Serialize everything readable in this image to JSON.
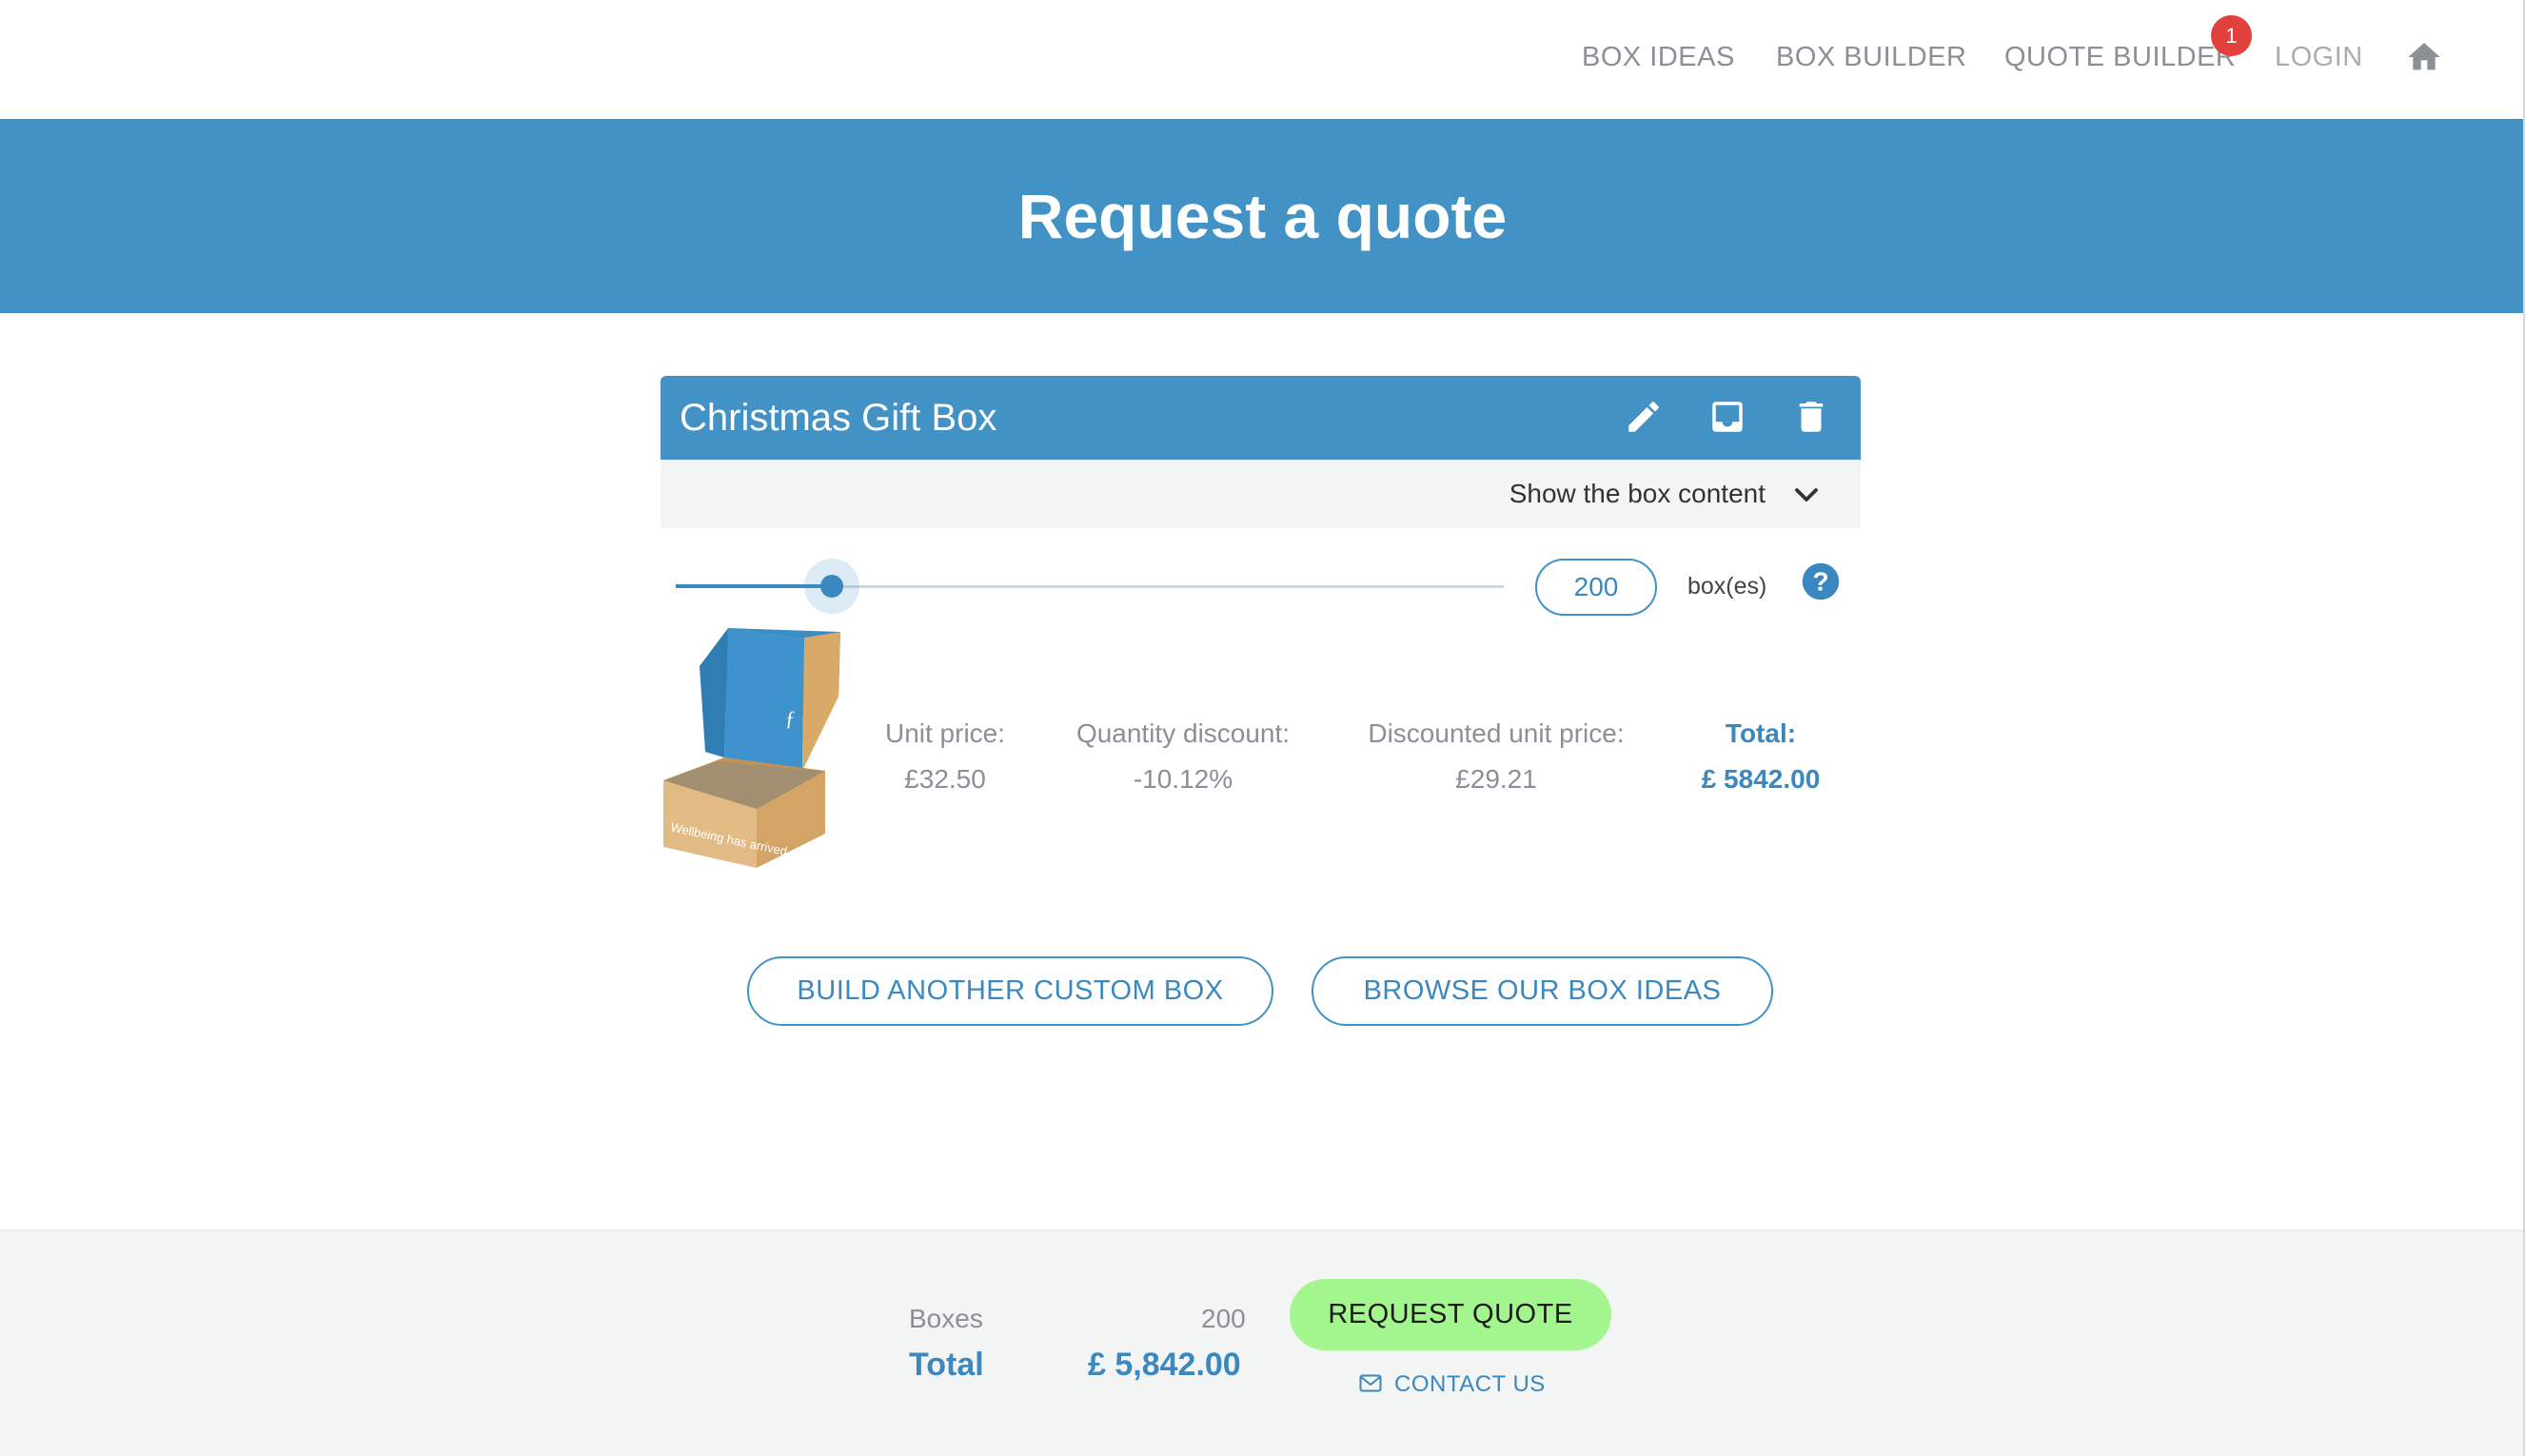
{
  "nav": {
    "items": [
      "BOX IDEAS",
      "BOX BUILDER",
      "QUOTE BUILDER"
    ],
    "login": "LOGIN",
    "cart_badge": "1",
    "home_icon": "home-icon"
  },
  "banner": {
    "title": "Request a quote"
  },
  "box": {
    "title": "Christmas Gift Box",
    "actions": [
      "pencil-icon",
      "inbox-icon",
      "trash-icon"
    ],
    "content_toggle": "Show the box content",
    "quantity": "200",
    "quantity_unit": "box(es)",
    "slider_fraction": 0.2,
    "box_print": "Wellbeing has arrived",
    "unit_price_label": "Unit price:",
    "unit_price": "£32.50",
    "discount_label": "Quantity discount:",
    "discount": "-10.12%",
    "discounted_label": "Discounted unit price:",
    "discounted_price": "£29.21",
    "total_label": "Total:",
    "total": "£ 5842.00"
  },
  "buttons": {
    "build": "BUILD ANOTHER CUSTOM BOX",
    "browse": "BROWSE OUR BOX IDEAS"
  },
  "footer": {
    "boxes_label": "Boxes",
    "boxes_value": "200",
    "total_label": "Total",
    "total_value": "£ 5,842.00",
    "request_button": "REQUEST QUOTE",
    "contact": "CONTACT US"
  },
  "colors": {
    "brand_blue": "#4292c6",
    "accent_green": "#a3f58e",
    "badge_red": "#e2403d"
  }
}
